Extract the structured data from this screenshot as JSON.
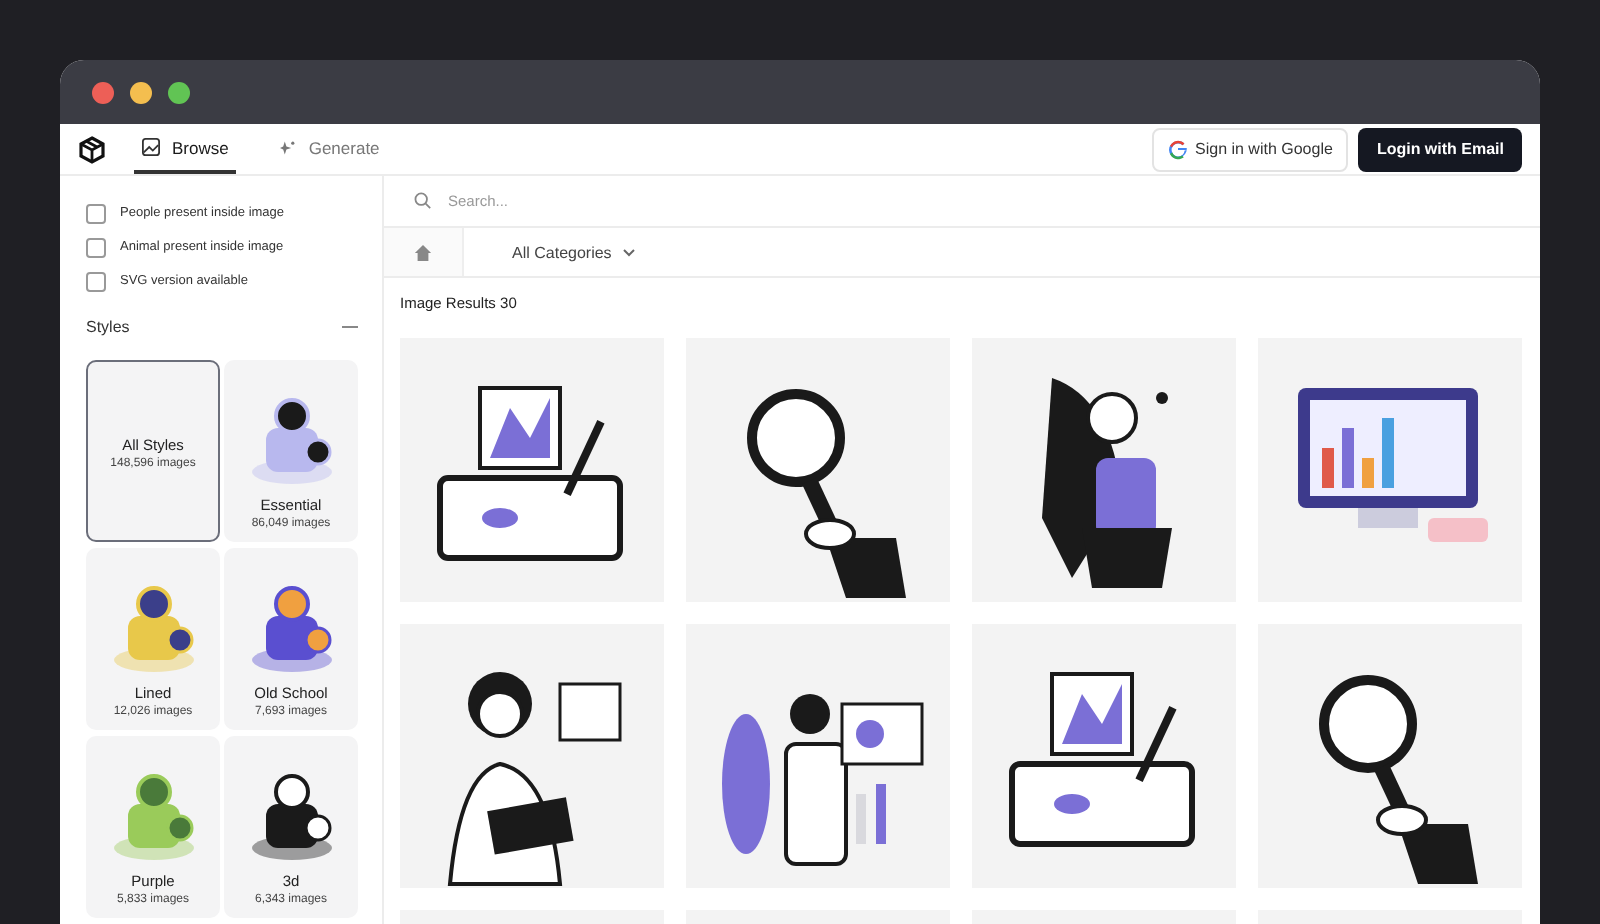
{
  "nav": {
    "tabs": [
      {
        "label": "Browse",
        "selected": true,
        "kind": "browse"
      },
      {
        "label": "Generate",
        "selected": false,
        "kind": "generate"
      }
    ],
    "google_button": "Sign in with Google",
    "email_button": "Login with Email"
  },
  "filters": [
    {
      "label": "People present inside image",
      "checked": false
    },
    {
      "label": "Animal present inside image",
      "checked": false
    },
    {
      "label": "SVG version available",
      "checked": false
    }
  ],
  "styles": {
    "title": "Styles",
    "expanded": true,
    "items": [
      {
        "name": "All Styles",
        "count": "148,596 images",
        "selected": true,
        "kind": "text"
      },
      {
        "name": "Essential",
        "count": "86,049 images",
        "selected": false,
        "kind": "picture"
      },
      {
        "name": "Lined",
        "count": "12,026 images",
        "selected": false,
        "kind": "picture"
      },
      {
        "name": "Old School",
        "count": "7,693 images",
        "selected": false,
        "kind": "picture"
      },
      {
        "name": "Purple",
        "count": "5,833 images",
        "selected": false,
        "kind": "picture"
      },
      {
        "name": "3d",
        "count": "6,343 images",
        "selected": false,
        "kind": "picture"
      }
    ]
  },
  "search": {
    "placeholder": "Search..."
  },
  "breadcrumb": {
    "category": "All Categories"
  },
  "results_label": "Image Results 30"
}
